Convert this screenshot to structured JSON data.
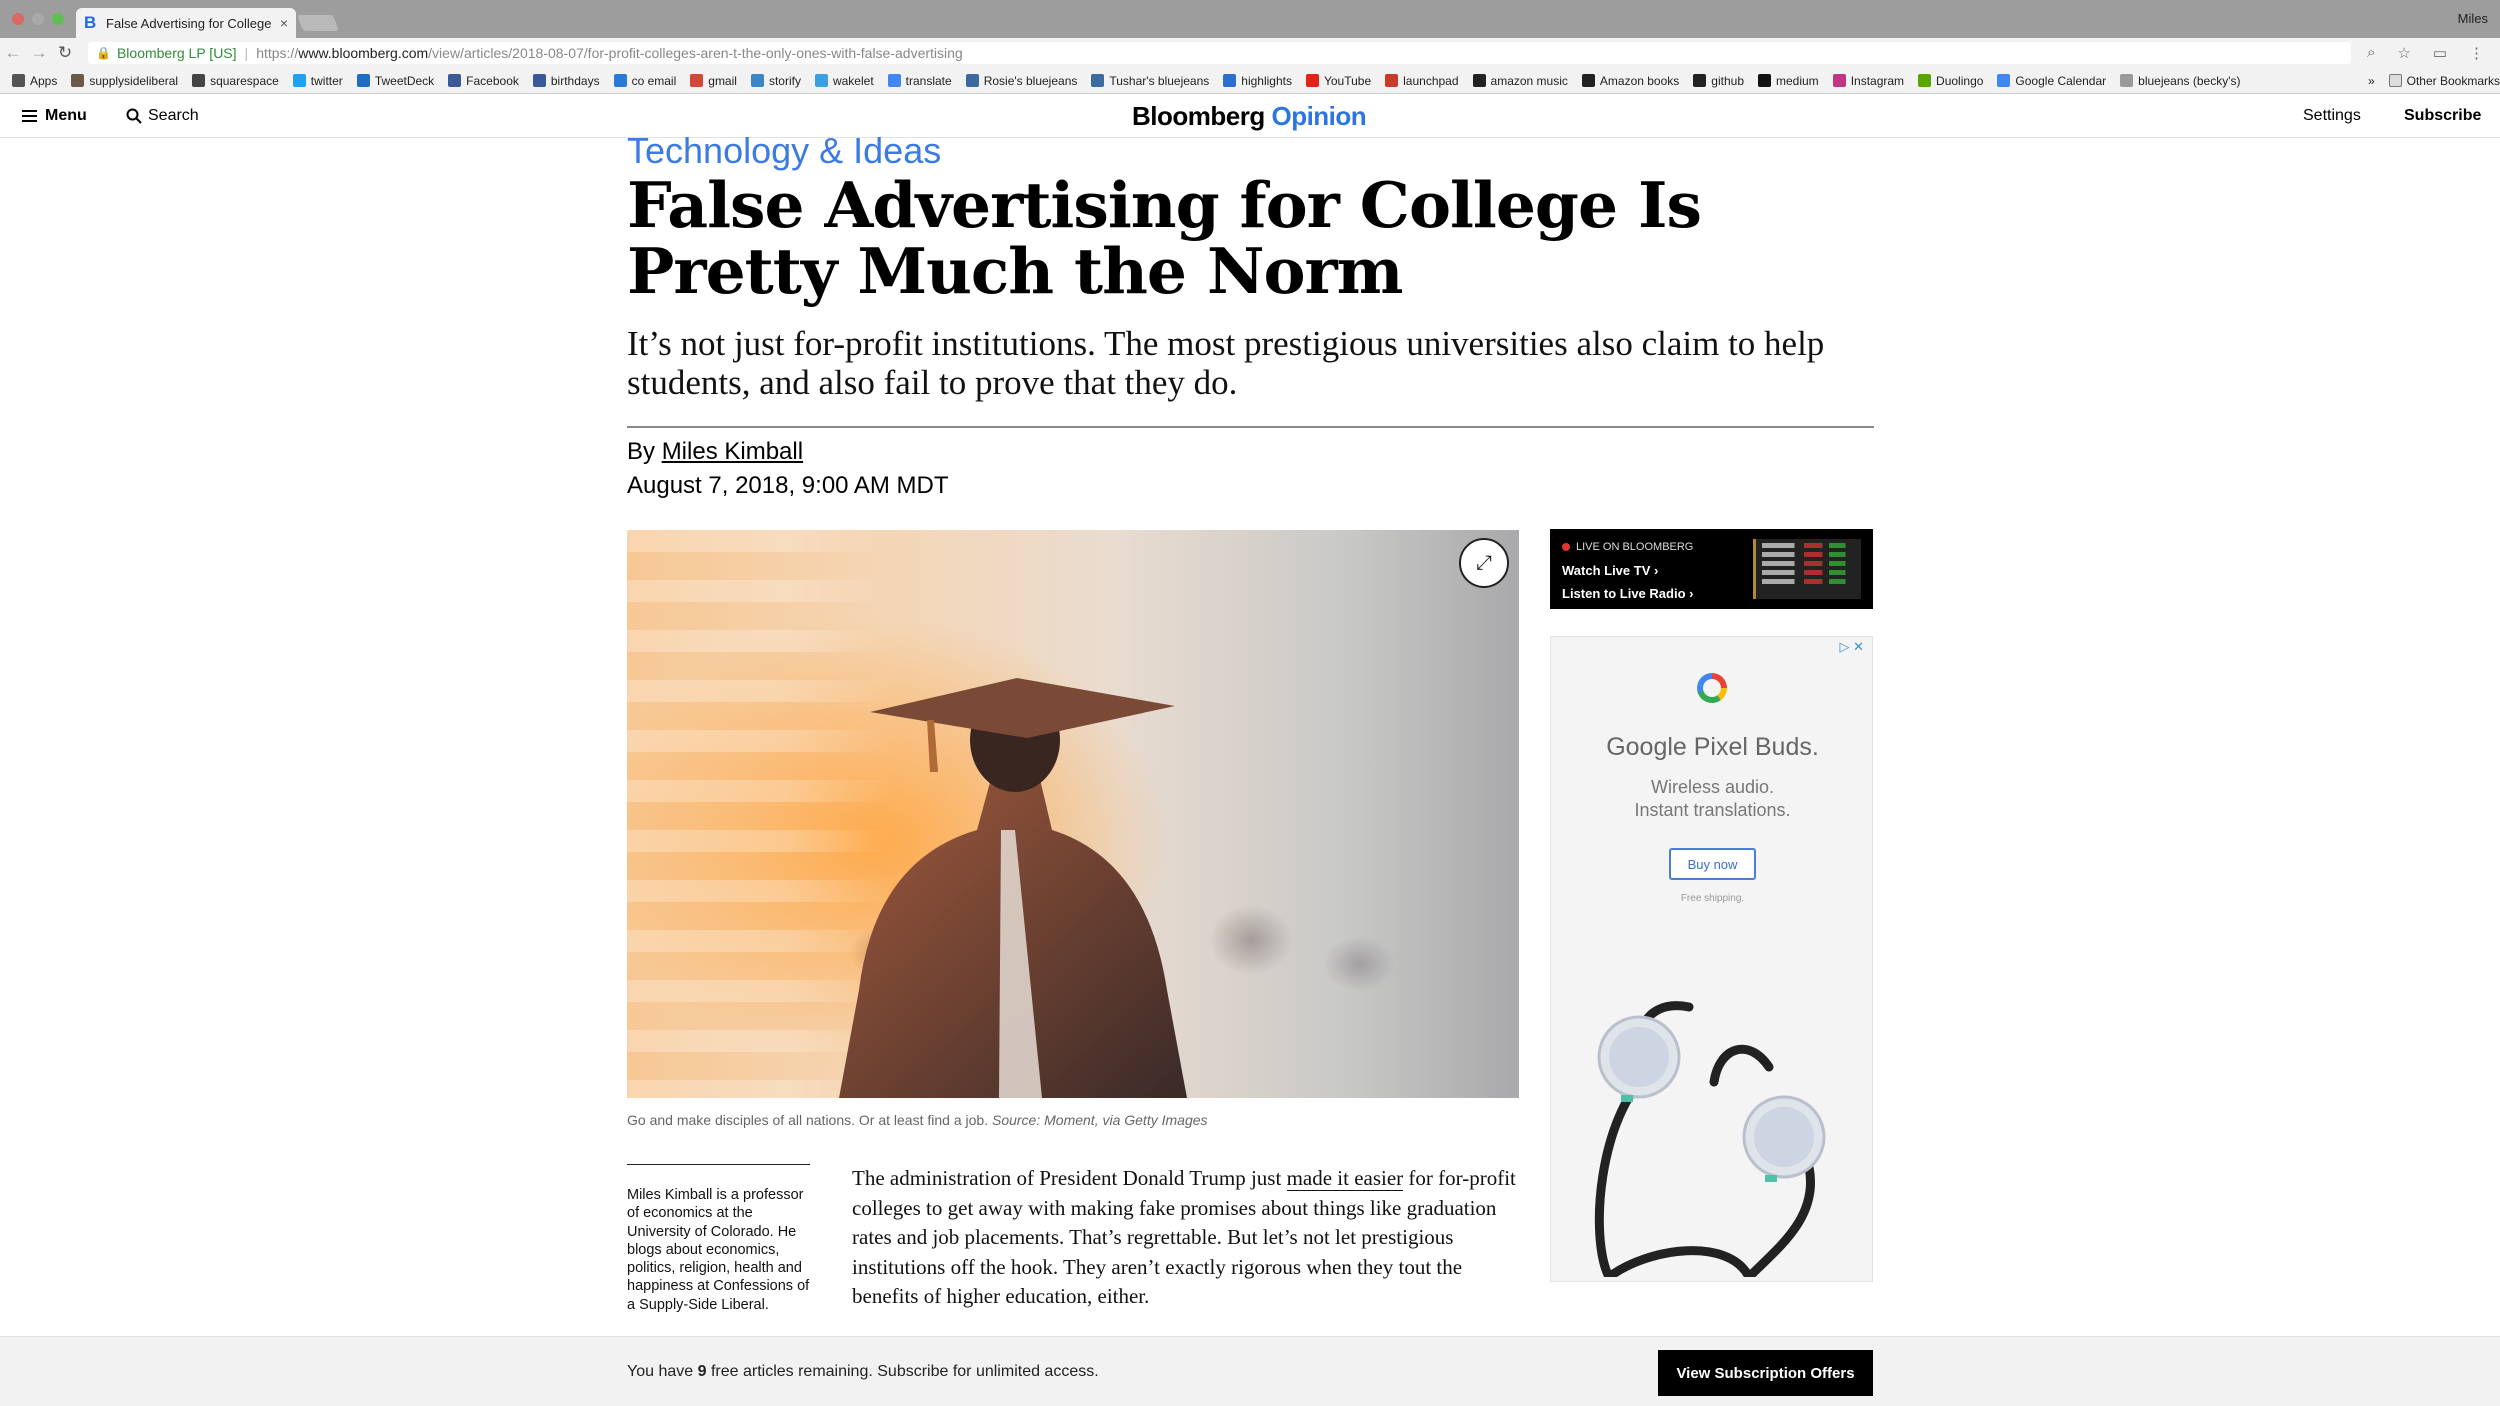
{
  "browser": {
    "tab_title": "False Advertising for College Is",
    "user_name": "Miles",
    "secure_label": "Bloomberg LP [US]",
    "url_scheme": "https://",
    "url_host": "www.bloomberg.com",
    "url_path": "/view/articles/2018-08-07/for-profit-colleges-aren-t-the-only-ones-with-false-advertising",
    "bookmarks": [
      {
        "label": "Apps",
        "color": "#555555"
      },
      {
        "label": "supplysideliberal",
        "color": "#6b5a4a"
      },
      {
        "label": "squarespace",
        "color": "#444444"
      },
      {
        "label": "twitter",
        "color": "#1da1f2"
      },
      {
        "label": "TweetDeck",
        "color": "#1b6ec2"
      },
      {
        "label": "Facebook",
        "color": "#3b5998"
      },
      {
        "label": "birthdays",
        "color": "#3b5998"
      },
      {
        "label": "co email",
        "color": "#2a7bd8"
      },
      {
        "label": "gmail",
        "color": "#d44638"
      },
      {
        "label": "storify",
        "color": "#3a86c8"
      },
      {
        "label": "wakelet",
        "color": "#3aa0e0"
      },
      {
        "label": "translate",
        "color": "#4285f4"
      },
      {
        "label": "Rosie's bluejeans",
        "color": "#3a6aa0"
      },
      {
        "label": "Tushar's bluejeans",
        "color": "#3a6aa0"
      },
      {
        "label": "highlights",
        "color": "#2a6fd0"
      },
      {
        "label": "YouTube",
        "color": "#e62117"
      },
      {
        "label": "launchpad",
        "color": "#c83a2a"
      },
      {
        "label": "amazon music",
        "color": "#222222"
      },
      {
        "label": "Amazon books",
        "color": "#222222"
      },
      {
        "label": "github",
        "color": "#222222"
      },
      {
        "label": "medium",
        "color": "#111111"
      },
      {
        "label": "Instagram",
        "color": "#c13584"
      },
      {
        "label": "Duolingo",
        "color": "#58a700"
      },
      {
        "label": "Google Calendar",
        "color": "#4285f4"
      },
      {
        "label": "bluejeans (becky's)",
        "color": "#999999"
      }
    ],
    "bookmarks_overflow": "»",
    "other_bookmarks": "Other Bookmarks"
  },
  "site_header": {
    "menu_label": "Menu",
    "search_label": "Search",
    "logo_bloomberg": "Bloomberg",
    "logo_opinion": "Opinion",
    "settings_label": "Settings",
    "subscribe_label": "Subscribe"
  },
  "article": {
    "section": "Technology & Ideas",
    "headline": "False Advertising for College Is Pretty Much the Norm",
    "dek": "It’s not just for-profit institutions. The most prestigious universities also claim to help students, and also fail to prove that they do.",
    "byline_prefix": "By",
    "author": "Miles Kimball",
    "date": "August 7, 2018, 9:00 AM MDT",
    "caption": "Go and make disciples of all nations. Or at least find a job.",
    "caption_source": "Source: Moment, via Getty Images",
    "bio": "Miles Kimball is a professor of economics at the University of Colorado. He blogs about economics, politics, religion, health and happiness at Confessions of a Supply-Side Liberal.",
    "body_before_link": "The administration of President Donald Trump just",
    "body_link": "made it easier",
    "body_after_link": "for for-profit colleges to get away with making fake promises about things like graduation rates and job placements. That’s regrettable. But let’s not let prestigious institutions off the hook. They aren’t exactly rigorous when they tout the benefits of higher education, either."
  },
  "live_box": {
    "live_label": "LIVE ON BLOOMBERG",
    "watch_tv": "Watch Live TV",
    "listen_radio": "Listen to Live Radio"
  },
  "ad": {
    "title": "Google Pixel Buds.",
    "line1": "Wireless audio.",
    "line2": "Instant translations.",
    "button": "Buy now",
    "shipping": "Free shipping."
  },
  "paywall": {
    "text_before": "You have",
    "count": "9",
    "text_after": "free articles remaining. Subscribe for unlimited access.",
    "button": "View Subscription Offers"
  }
}
